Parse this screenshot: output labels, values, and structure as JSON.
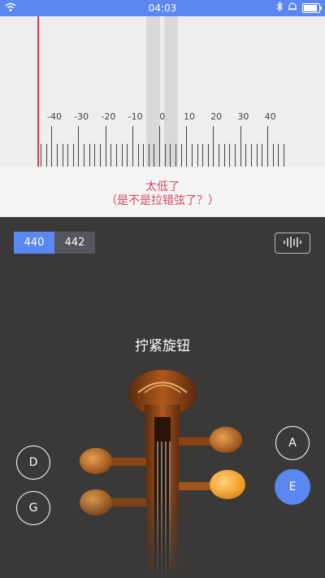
{
  "status_bar": {
    "time": "04:03"
  },
  "meter": {
    "scale_labels": [
      "-40",
      "-30",
      "-20",
      "-10",
      "0",
      "10",
      "20",
      "30",
      "40"
    ],
    "deviation_cents": -46
  },
  "feedback": {
    "line1": "太低了",
    "line2": "（是不是拉错弦了？）"
  },
  "reference": {
    "options": [
      "440",
      "442"
    ],
    "selected": "440"
  },
  "instruction": "拧紧旋钮",
  "strings": {
    "d": "D",
    "g": "G",
    "a": "A",
    "e": "E",
    "selected": "E"
  },
  "colors": {
    "accent": "#5b87f0",
    "warning_text": "#d44a5e",
    "needle": "#e23b3b",
    "dark_bg": "#3b3937"
  },
  "icons": [
    "wifi-icon",
    "bluetooth-icon",
    "alarm-icon",
    "battery-icon",
    "waveform-icon"
  ]
}
